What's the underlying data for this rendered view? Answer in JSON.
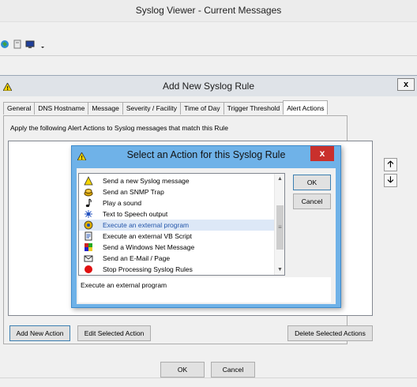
{
  "window": {
    "title": "Syslog Viewer - Current Messages"
  },
  "toolbar": {
    "icons": [
      "globe-icon",
      "document-icon",
      "monitor-icon",
      "dropdown-arrow-icon"
    ]
  },
  "rule_dialog": {
    "title": "Add New Syslog Rule",
    "close_label": "x",
    "tabs": [
      {
        "label": "General"
      },
      {
        "label": "DNS Hostname"
      },
      {
        "label": "Message"
      },
      {
        "label": "Severity / Facility"
      },
      {
        "label": "Time of Day"
      },
      {
        "label": "Trigger Threshold"
      },
      {
        "label": "Alert Actions"
      }
    ],
    "active_tab": "Alert Actions",
    "instruction": "Apply the following Alert Actions to Syslog messages that match this Rule",
    "move_up": "🡡",
    "move_down": "🡣",
    "add_label": "Add New Action",
    "edit_label": "Edit Selected Action",
    "delete_label": "Delete Selected Actions",
    "ok_label": "OK",
    "cancel_label": "Cancel"
  },
  "action_dialog": {
    "title": "Select an Action for this Syslog Rule",
    "close_label": "x",
    "ok_label": "OK",
    "cancel_label": "Cancel",
    "items": [
      {
        "label": "Send a new Syslog message",
        "icon": "warning-icon"
      },
      {
        "label": "Send an SNMP Trap",
        "icon": "trap-icon"
      },
      {
        "label": "Play a sound",
        "icon": "music-note-icon"
      },
      {
        "label": "Text to Speech output",
        "icon": "speech-icon"
      },
      {
        "label": "Execute an external program",
        "icon": "gear-icon"
      },
      {
        "label": "Execute an external VB Script",
        "icon": "script-icon"
      },
      {
        "label": "Send a Windows Net Message",
        "icon": "net-message-icon"
      },
      {
        "label": "Send an E-Mail / Page",
        "icon": "envelope-icon"
      },
      {
        "label": "Stop Processing Syslog Rules",
        "icon": "stop-icon"
      }
    ],
    "selected": "Execute an external program",
    "description": "Execute an external program"
  },
  "colors": {
    "dialog_accent": "#6fb2e8",
    "close_red": "#c9302c",
    "selection": "#dde8f7"
  }
}
